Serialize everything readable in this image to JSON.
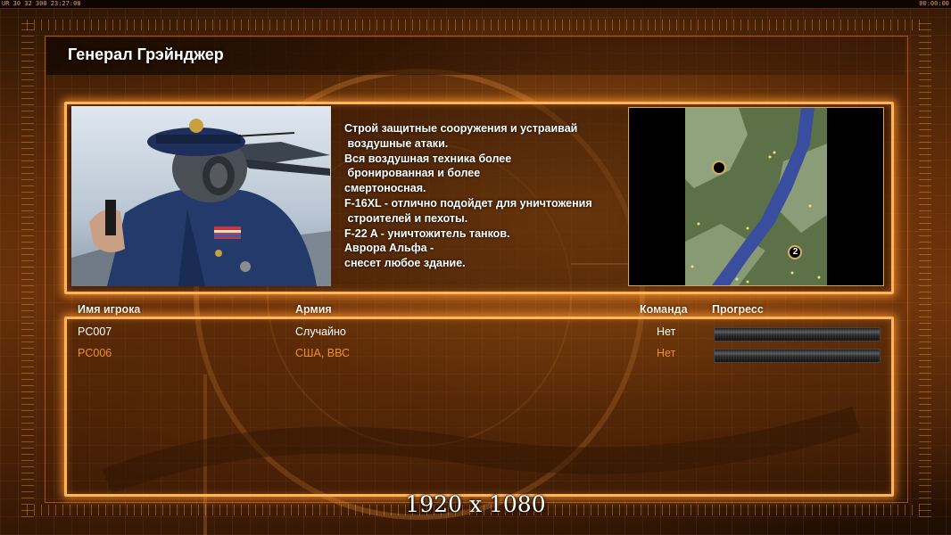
{
  "hud": {
    "top_left": "UR 30 32 300 23:27:08",
    "top_right": "00:00:00"
  },
  "general": {
    "name": "Генерал Грэйнджер",
    "description_lines": [
      "Строй защитные сооружения и устраивай",
      " воздушные атаки.",
      "Вся воздушная техника более",
      " бронированная и более",
      "смертоносная.",
      "F-16XL - отлично подойдет для уничтожения",
      " строителей и пехоты.",
      "F-22 A - уничтожитель танков.",
      "Аврора Альфа -",
      "снесет любое здание."
    ]
  },
  "map": {
    "start_markers": [
      "",
      "2"
    ]
  },
  "players_table": {
    "headers": {
      "name": "Имя игрока",
      "army": "Армия",
      "team": "Команда",
      "progress": "Прогресс"
    },
    "rows": [
      {
        "name": "PC007",
        "army": "Случайно",
        "team": "Нет",
        "progress": 1.0,
        "color": "#ffffff"
      },
      {
        "name": "PC006",
        "army": "США, ВВС",
        "team": "Нет",
        "progress": 1.0,
        "color": "#f0902a"
      }
    ]
  },
  "resolution_label": "1920 x 1080",
  "colors": {
    "panel_border": "#ffb45a",
    "accent_orange": "#f0902a",
    "text_white": "#ffffff"
  }
}
